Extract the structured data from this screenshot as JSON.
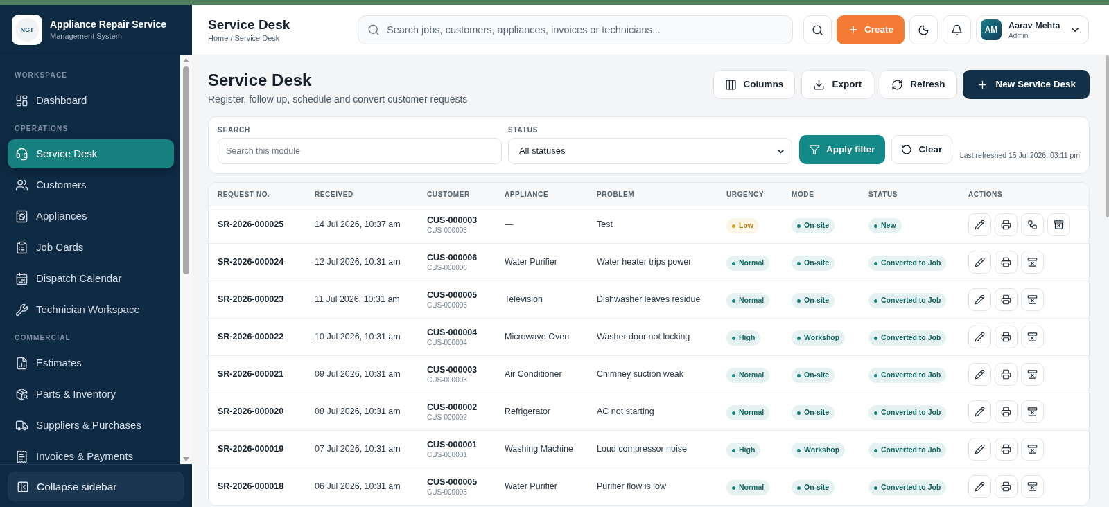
{
  "sidebar": {
    "logo_text": "NGT",
    "app_name": "Appliance Repair Service",
    "app_subtitle": "Management System",
    "sections": [
      {
        "label": "WORKSPACE",
        "items": [
          {
            "label": "Dashboard",
            "selected": false
          }
        ]
      },
      {
        "label": "OPERATIONS",
        "items": [
          {
            "label": "Service Desk",
            "selected": true
          },
          {
            "label": "Customers",
            "selected": false
          },
          {
            "label": "Appliances",
            "selected": false
          },
          {
            "label": "Job Cards",
            "selected": false
          },
          {
            "label": "Dispatch Calendar",
            "selected": false
          },
          {
            "label": "Technician Workspace",
            "selected": false
          }
        ]
      },
      {
        "label": "COMMERCIAL",
        "items": [
          {
            "label": "Estimates",
            "selected": false
          },
          {
            "label": "Parts & Inventory",
            "selected": false
          },
          {
            "label": "Suppliers & Purchases",
            "selected": false
          },
          {
            "label": "Invoices & Payments",
            "selected": false
          }
        ]
      }
    ],
    "collapse_button": "Collapse sidebar"
  },
  "top_bar": {
    "title": "Service Desk",
    "breadcrumb": "Home / Service Desk",
    "search": {
      "placeholder": "Search jobs, customers, appliances, invoices or technicians..."
    },
    "create_button": "Create",
    "user": {
      "initials": "AM",
      "name": "Aarav Mehta",
      "role": "Admin"
    }
  },
  "page": {
    "title": "Service Desk",
    "subtitle": "Register, follow up, schedule and convert customer requests",
    "actions": [
      {
        "label": "Columns",
        "kind": "secondary"
      },
      {
        "label": "Export",
        "kind": "secondary"
      },
      {
        "label": "Refresh",
        "kind": "secondary"
      },
      {
        "label": "New Service Desk",
        "kind": "primary"
      }
    ]
  },
  "filters": {
    "search": {
      "label": "SEARCH",
      "placeholder": "Search this module"
    },
    "status": {
      "label": "STATUS",
      "value": "All statuses"
    },
    "apply_button": "Apply filter",
    "clear_button": "Clear",
    "last_refreshed": "Last refreshed 15 Jul 2026, 03:11 pm"
  },
  "table": {
    "columns": [
      "REQUEST NO.",
      "RECEIVED",
      "CUSTOMER",
      "APPLIANCE",
      "PROBLEM",
      "URGENCY",
      "MODE",
      "STATUS",
      "ACTIONS"
    ],
    "rows": [
      {
        "request_no": "SR-2026-000025",
        "received": "14 Jul 2026, 10:37 am",
        "customer": "CUS-000003",
        "customer_code": "CUS-000003",
        "appliance": "—",
        "problem": "Test",
        "urgency": {
          "label": "Low",
          "color": "#d9a024"
        },
        "mode": "On-site",
        "status": "New",
        "convertible": true
      },
      {
        "request_no": "SR-2026-000024",
        "received": "12 Jul 2026, 10:31 am",
        "customer": "CUS-000006",
        "customer_code": "CUS-000006",
        "appliance": "Water Purifier",
        "problem": "Water heater trips power",
        "urgency": {
          "label": "Normal",
          "color": "#1a8a84"
        },
        "mode": "On-site",
        "status": "Converted to Job",
        "convertible": false
      },
      {
        "request_no": "SR-2026-000023",
        "received": "11 Jul 2026, 10:31 am",
        "customer": "CUS-000005",
        "customer_code": "CUS-000005",
        "appliance": "Television",
        "problem": "Dishwasher leaves residue",
        "urgency": {
          "label": "Normal",
          "color": "#1a8a84"
        },
        "mode": "On-site",
        "status": "Converted to Job",
        "convertible": false
      },
      {
        "request_no": "SR-2026-000022",
        "received": "10 Jul 2026, 10:31 am",
        "customer": "CUS-000004",
        "customer_code": "CUS-000004",
        "appliance": "Microwave Oven",
        "problem": "Washer door not locking",
        "urgency": {
          "label": "High",
          "color": "#1a8a84"
        },
        "mode": "Workshop",
        "status": "Converted to Job",
        "convertible": false
      },
      {
        "request_no": "SR-2026-000021",
        "received": "09 Jul 2026, 10:31 am",
        "customer": "CUS-000003",
        "customer_code": "CUS-000003",
        "appliance": "Air Conditioner",
        "problem": "Chimney suction weak",
        "urgency": {
          "label": "Normal",
          "color": "#1a8a84"
        },
        "mode": "On-site",
        "status": "Converted to Job",
        "convertible": false
      },
      {
        "request_no": "SR-2026-000020",
        "received": "08 Jul 2026, 10:31 am",
        "customer": "CUS-000002",
        "customer_code": "CUS-000002",
        "appliance": "Refrigerator",
        "problem": "AC not starting",
        "urgency": {
          "label": "Normal",
          "color": "#1a8a84"
        },
        "mode": "On-site",
        "status": "Converted to Job",
        "convertible": false
      },
      {
        "request_no": "SR-2026-000019",
        "received": "07 Jul 2026, 10:31 am",
        "customer": "CUS-000001",
        "customer_code": "CUS-000001",
        "appliance": "Washing Machine",
        "problem": "Loud compressor noise",
        "urgency": {
          "label": "High",
          "color": "#1a8a84"
        },
        "mode": "Workshop",
        "status": "Converted to Job",
        "convertible": false
      },
      {
        "request_no": "SR-2026-000018",
        "received": "06 Jul 2026, 10:31 am",
        "customer": "CUS-000005",
        "customer_code": "CUS-000005",
        "appliance": "Water Purifier",
        "problem": "Purifier flow is low",
        "urgency": {
          "label": "Normal",
          "color": "#1a8a84"
        },
        "mode": "On-site",
        "status": "Converted to Job",
        "convertible": false
      }
    ]
  }
}
